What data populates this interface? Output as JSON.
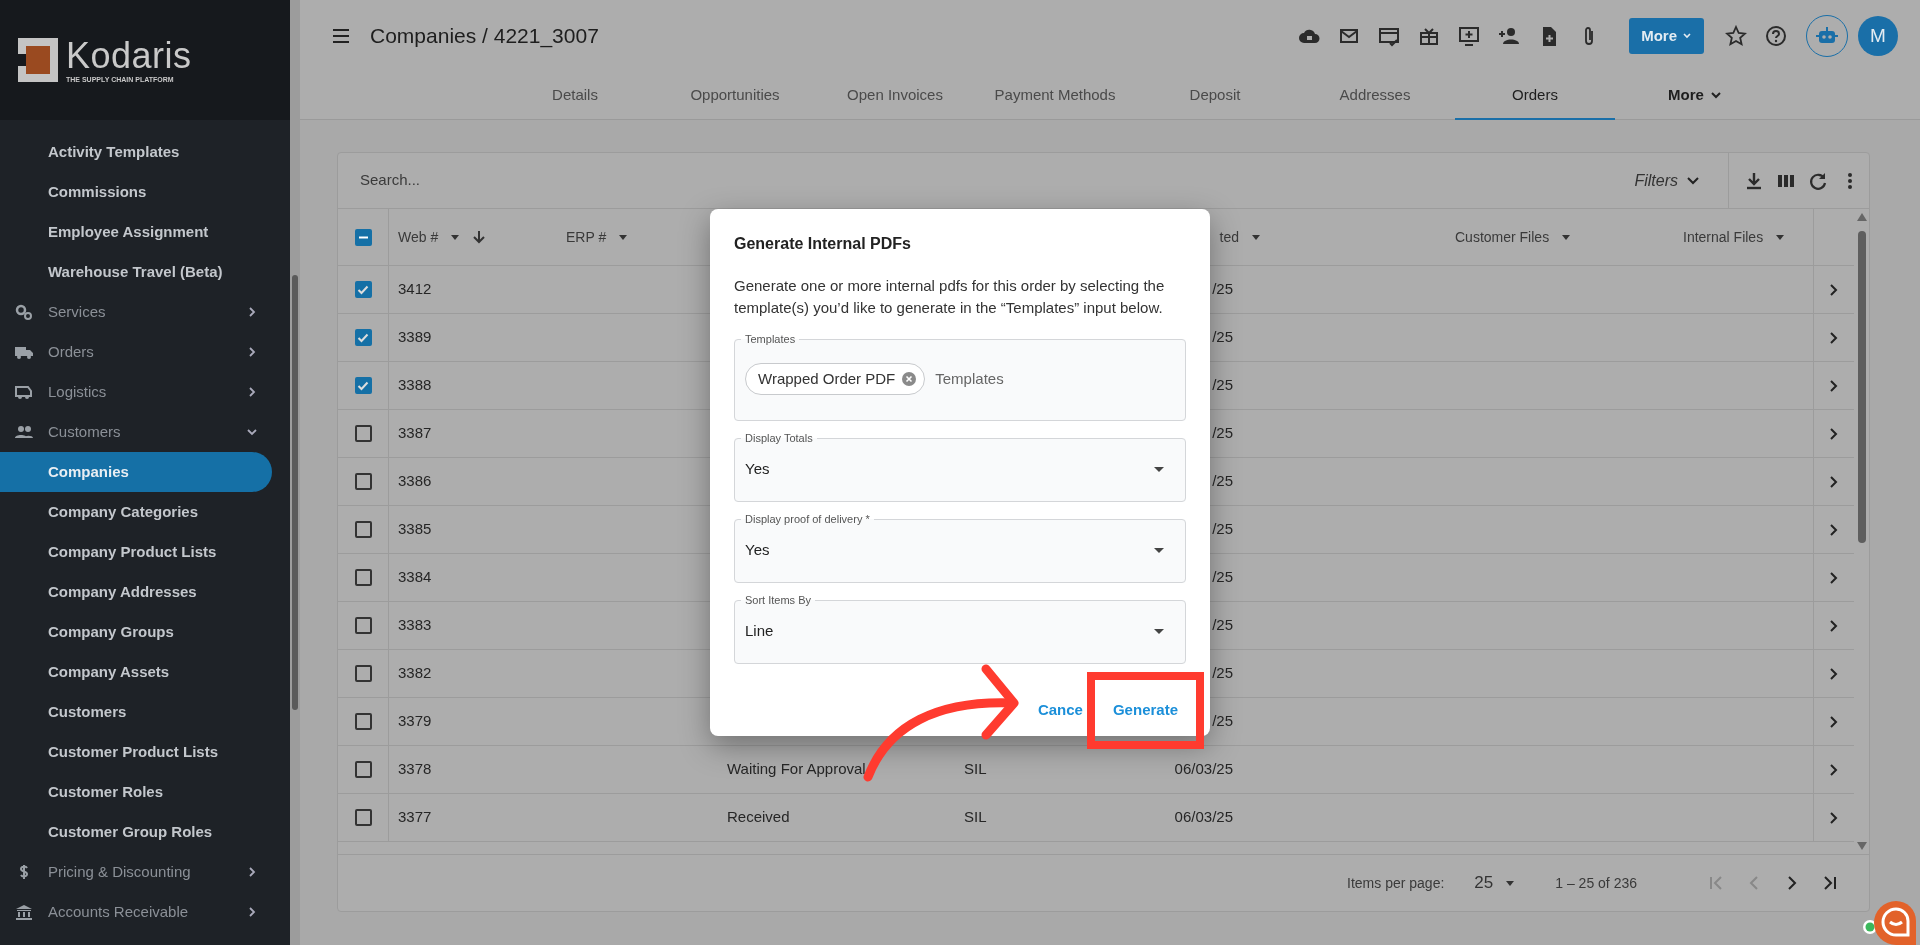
{
  "sidebar": {
    "logo": {
      "name": "Kodaris",
      "tagline": "THE SUPPLY CHAIN PLATFORM"
    },
    "items": [
      {
        "label": "Activity Templates",
        "kind": "link",
        "selected": false
      },
      {
        "label": "Commissions",
        "kind": "link",
        "selected": false
      },
      {
        "label": "Employee Assignment",
        "kind": "link",
        "selected": false
      },
      {
        "label": "Warehouse Travel (Beta)",
        "kind": "link",
        "selected": false
      },
      {
        "label": "Services",
        "kind": "group",
        "selected": false,
        "expanded": false
      },
      {
        "label": "Orders",
        "kind": "group",
        "selected": false,
        "expanded": false
      },
      {
        "label": "Logistics",
        "kind": "group",
        "selected": false,
        "expanded": false
      },
      {
        "label": "Customers",
        "kind": "group",
        "selected": false,
        "expanded": true
      },
      {
        "label": "Companies",
        "kind": "link",
        "selected": true
      },
      {
        "label": "Company Categories",
        "kind": "link",
        "selected": false
      },
      {
        "label": "Company Product Lists",
        "kind": "link",
        "selected": false
      },
      {
        "label": "Company Addresses",
        "kind": "link",
        "selected": false
      },
      {
        "label": "Company Groups",
        "kind": "link",
        "selected": false
      },
      {
        "label": "Company Assets",
        "kind": "link",
        "selected": false
      },
      {
        "label": "Customers",
        "kind": "link",
        "selected": false
      },
      {
        "label": "Customer Product Lists",
        "kind": "link",
        "selected": false
      },
      {
        "label": "Customer Roles",
        "kind": "link",
        "selected": false
      },
      {
        "label": "Customer Group Roles",
        "kind": "link",
        "selected": false
      },
      {
        "label": "Pricing & Discounting",
        "kind": "group",
        "selected": false,
        "expanded": false
      },
      {
        "label": "Accounts Receivable",
        "kind": "group",
        "selected": false,
        "expanded": false
      }
    ]
  },
  "header": {
    "breadcrumb": "Companies / 4221_3007",
    "more_button": "More",
    "avatar": "M"
  },
  "tabs": [
    {
      "label": "Details",
      "kind": "tab",
      "selected": false
    },
    {
      "label": "Opportunities",
      "kind": "tab",
      "selected": false
    },
    {
      "label": "Open Invoices",
      "kind": "tab",
      "selected": false
    },
    {
      "label": "Payment Methods",
      "kind": "tab",
      "selected": false
    },
    {
      "label": "Deposit",
      "kind": "tab",
      "selected": false
    },
    {
      "label": "Addresses",
      "kind": "tab",
      "selected": false
    },
    {
      "label": "Orders",
      "kind": "tab",
      "selected": true
    },
    {
      "label": "More",
      "kind": "menu",
      "selected": false
    }
  ],
  "table": {
    "search": {
      "placeholder": "Search..."
    },
    "filters": "Filters",
    "select_all_indeterminate": true,
    "columns": [
      {
        "label": "Web #",
        "sorted": true
      },
      {
        "label": "ERP #",
        "sorted": false
      },
      {
        "label": "ted",
        "sorted": false
      },
      {
        "label": "Customer Files",
        "sorted": false
      },
      {
        "label": "Internal Files",
        "sorted": false
      }
    ],
    "rows": [
      {
        "checked": true,
        "web": "3412",
        "date": "/25"
      },
      {
        "checked": true,
        "web": "3389",
        "date": "/25"
      },
      {
        "checked": true,
        "web": "3388",
        "date": "/25"
      },
      {
        "checked": false,
        "web": "3387",
        "date": "/25"
      },
      {
        "checked": false,
        "web": "3386",
        "date": "/25"
      },
      {
        "checked": false,
        "web": "3385",
        "date": "/25"
      },
      {
        "checked": false,
        "web": "3384",
        "date": "/25"
      },
      {
        "checked": false,
        "web": "3383",
        "date": "/25"
      },
      {
        "checked": false,
        "web": "3382",
        "date": "/25"
      },
      {
        "checked": false,
        "web": "3379",
        "date": "/25"
      },
      {
        "checked": false,
        "web": "3378",
        "status": "Waiting For Approval",
        "column_5": "SIL",
        "date": "06/03/25"
      },
      {
        "checked": false,
        "web": "3377",
        "status": "Received",
        "column_5": "SIL",
        "date": "06/03/25"
      }
    ],
    "footer": {
      "items_per_page_label": "Items per page:",
      "items_per_page": "25",
      "range": "1 – 25 of 236"
    }
  },
  "dialog": {
    "title": "Generate Internal PDFs",
    "text": "Generate one or more internal pdfs for this order by selecting the template(s) you’d like to generate in the “Templates” input below.",
    "fields": [
      {
        "kind": "chips",
        "label": "Templates",
        "chips": [
          "Wrapped Order PDF"
        ],
        "placeholder": "Templates"
      },
      {
        "kind": "select",
        "label": "Display Totals",
        "value": "Yes"
      },
      {
        "kind": "select",
        "label": "Display proof of delivery *",
        "value": "Yes"
      },
      {
        "kind": "select",
        "label": "Sort Items By",
        "value": "Line"
      }
    ],
    "buttons": [
      {
        "label": "Cance",
        "highlighted": false
      },
      {
        "label": "Generate",
        "highlighted": true
      }
    ]
  },
  "callout_arrow": true
}
